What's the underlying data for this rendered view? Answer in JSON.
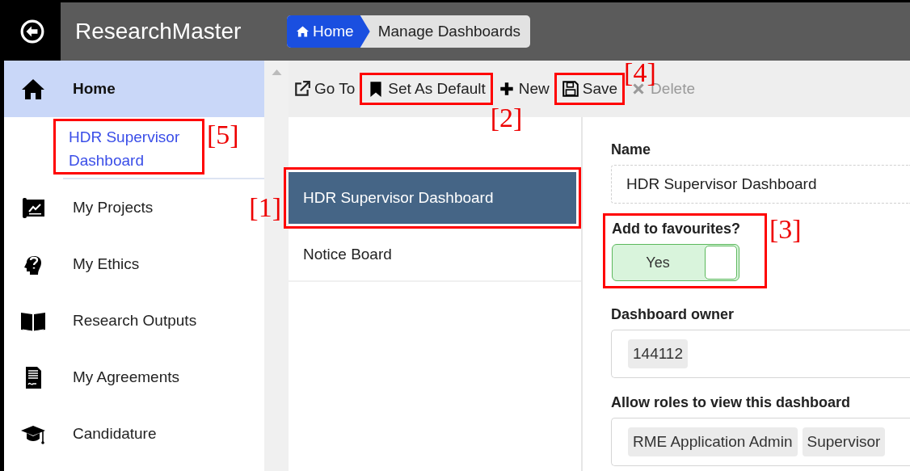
{
  "app": {
    "title": "ResearchMaster"
  },
  "breadcrumb": [
    {
      "label": "Home",
      "kind": "home"
    },
    {
      "label": "Manage Dashboards",
      "kind": "page"
    }
  ],
  "sidebar": {
    "items": [
      {
        "label": "Home",
        "selected": true,
        "children": [
          {
            "label": "HDR Supervisor Dashboard",
            "selected": false,
            "callout": "[5]"
          }
        ]
      },
      {
        "label": "My Projects",
        "selected": false
      },
      {
        "label": "My Ethics",
        "selected": false
      },
      {
        "label": "Research Outputs",
        "selected": false
      },
      {
        "label": "My Agreements",
        "selected": false
      },
      {
        "label": "Candidature",
        "selected": false
      }
    ]
  },
  "toolbar": [
    {
      "label": "Go To",
      "disabled": false
    },
    {
      "label": "Set As Default",
      "disabled": false,
      "callout": "[2]"
    },
    {
      "label": "New",
      "disabled": false
    },
    {
      "label": "Save",
      "disabled": false,
      "callout": "[4]"
    },
    {
      "label": "Delete",
      "disabled": true
    }
  ],
  "dashboards": [
    {
      "label": "HDR Supervisor Dashboard",
      "selected": true,
      "callout": "[1]"
    },
    {
      "label": "Notice Board",
      "selected": false
    }
  ],
  "form": {
    "name": {
      "label": "Name",
      "value": "HDR Supervisor Dashboard"
    },
    "favourites": {
      "label": "Add to favourites?",
      "on": true,
      "text": "Yes",
      "callout": "[3]"
    },
    "owner": {
      "label": "Dashboard owner",
      "chips": [
        "144112"
      ]
    },
    "roles": {
      "label": "Allow roles to view this dashboard",
      "chips": [
        "RME Application Admin",
        "Supervisor"
      ]
    }
  }
}
